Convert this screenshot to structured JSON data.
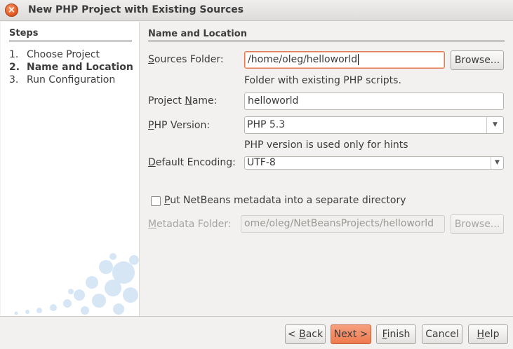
{
  "window": {
    "title": "New PHP Project with Existing Sources"
  },
  "steps": {
    "heading": "Steps",
    "items": [
      {
        "num": "1.",
        "label": "Choose Project"
      },
      {
        "num": "2.",
        "label": "Name and Location"
      },
      {
        "num": "3.",
        "label": "Run Configuration"
      }
    ]
  },
  "panel": {
    "heading": "Name and Location",
    "sources_folder": {
      "label_pre": "",
      "label_ul": "S",
      "label_post": "ources Folder:",
      "value": "/home/oleg/helloworld",
      "hint": "Folder with existing PHP scripts.",
      "browse": "Browse..."
    },
    "project_name": {
      "label_pre": "Project ",
      "label_ul": "N",
      "label_post": "ame:",
      "value": "helloworld"
    },
    "php_version": {
      "label_pre": "",
      "label_ul": "P",
      "label_post": "HP Version:",
      "value": "PHP 5.3",
      "hint": "PHP version is used only for hints"
    },
    "encoding": {
      "label_pre": "",
      "label_ul": "D",
      "label_post": "efault Encoding:",
      "value": "UTF-8"
    },
    "metadata_checkbox": {
      "label_pre": "",
      "label_ul": "P",
      "label_post": "ut NetBeans metadata into a separate directory",
      "checked": false
    },
    "metadata_folder": {
      "label_pre": "",
      "label_ul": "M",
      "label_post": "etadata Folder:",
      "value": "ome/oleg/NetBeansProjects/helloworld",
      "browse": "Browse..."
    }
  },
  "footer": {
    "back": {
      "pre": "< ",
      "ul": "B",
      "post": "ack"
    },
    "next": "Next >",
    "finish": {
      "pre": "",
      "ul": "F",
      "post": "inish"
    },
    "cancel": "Cancel",
    "help": {
      "pre": "",
      "ul": "H",
      "post": "elp"
    }
  },
  "colors": {
    "accent": "#ef7a4e",
    "focus_border": "#e07b53"
  }
}
